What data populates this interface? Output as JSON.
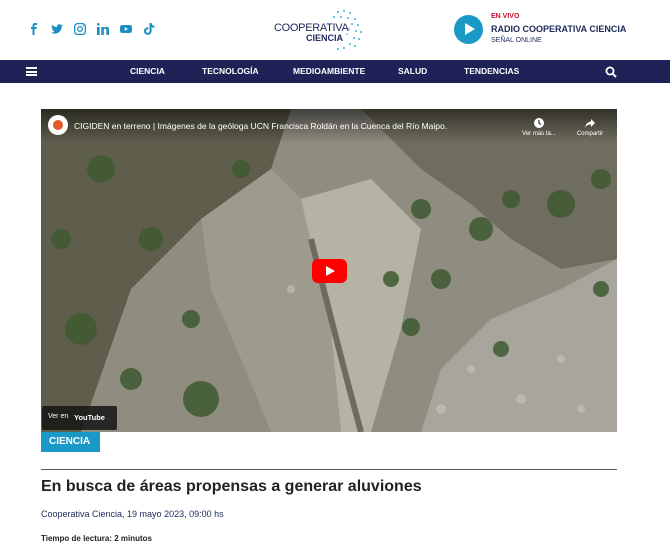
{
  "header": {
    "social_icons": [
      "facebook-icon",
      "twitter-icon",
      "instagram-icon",
      "linkedin-icon",
      "youtube-icon",
      "tiktok-icon"
    ],
    "logo": {
      "line1": "COOPERATIVA",
      "line2": "CIENCIA"
    },
    "radio": {
      "live_label": "EN VIVO",
      "station": "RADIO COOPERATIVA CIENCIA",
      "signal": "SEÑAL ONLINE"
    }
  },
  "nav": {
    "items": [
      "CIENCIA",
      "TECNOLOGÍA",
      "MEDIOAMBIENTE",
      "SALUD",
      "TENDENCIAS"
    ]
  },
  "video": {
    "title": "CIGIDEN en terreno | Imágenes de la geóloga UCN Francisca Roldán en la Cuenca del Río Maipo.",
    "watch_later": "Ver más ta...",
    "share": "Compartir",
    "watch_on": "Ver en",
    "youtube": "YouTube"
  },
  "article": {
    "category": "CIENCIA",
    "headline": "En busca de áreas propensas a generar aluviones",
    "byline": "Cooperativa Ciencia, 19 mayo 2023, 09:00 hs",
    "read_label": "Tiempo de lectura:",
    "read_value": "2 minutos"
  },
  "colors": {
    "accent": "#1a99c6",
    "nav_bg": "#1e2257",
    "live_red": "#c8102e",
    "youtube_red": "#ff0000"
  }
}
